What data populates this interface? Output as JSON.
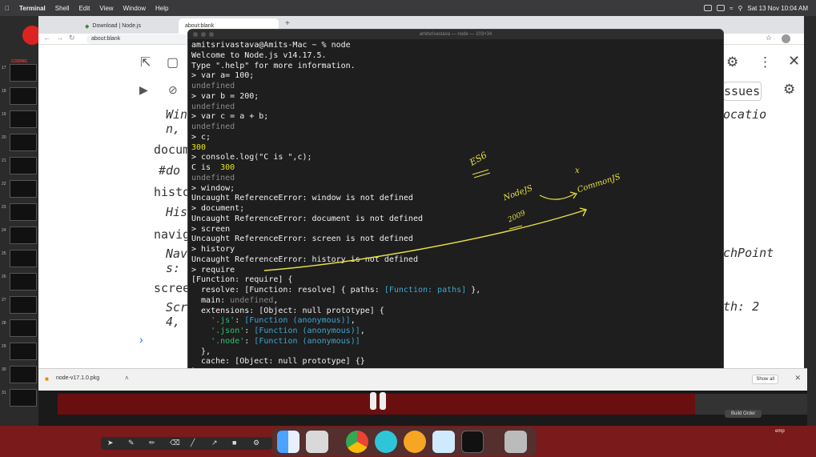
{
  "menubar": {
    "app": "Terminal",
    "items": [
      "Shell",
      "Edit",
      "View",
      "Window",
      "Help"
    ],
    "datetime": "Sat 13 Nov  10:04 AM"
  },
  "slides": {
    "brand": "CODING MENTORS",
    "numbers": [
      "17",
      "18",
      "19",
      "20",
      "21",
      "22",
      "23",
      "24",
      "25",
      "26",
      "27",
      "28",
      "29",
      "30",
      "31"
    ]
  },
  "browser": {
    "tabs": [
      {
        "label": "Download | Node.js"
      },
      {
        "label": "about:blank"
      }
    ],
    "url": "about:blank"
  },
  "devtools": {
    "left_rows": [
      "Win",
      "n,",
      "docum",
      "#do",
      "histo",
      "His",
      "navig",
      "Nav",
      "s:",
      "scree",
      "Scr",
      "4,"
    ],
    "right_rows": [
      "ssues",
      "ocatio",
      "chPoint",
      "th: 2"
    ]
  },
  "terminal": {
    "title": "amitsrivastava — node — 103×34",
    "lines": [
      [
        {
          "t": "amitsrivastava@Amits-Mac ~ % node",
          "c": ""
        }
      ],
      [
        {
          "t": "Welcome to Node.js v14.17.5.",
          "c": ""
        }
      ],
      [
        {
          "t": "Type \".help\" for more information.",
          "c": ""
        }
      ],
      [
        {
          "t": "> var a= 100;",
          "c": ""
        }
      ],
      [
        {
          "t": "undefined",
          "c": "undef"
        }
      ],
      [
        {
          "t": "> var b = 200;",
          "c": ""
        }
      ],
      [
        {
          "t": "undefined",
          "c": "undef"
        }
      ],
      [
        {
          "t": "> var c = a + b;",
          "c": ""
        }
      ],
      [
        {
          "t": "undefined",
          "c": "undef"
        }
      ],
      [
        {
          "t": "> c;",
          "c": ""
        }
      ],
      [
        {
          "t": "300",
          "c": "num"
        }
      ],
      [
        {
          "t": "> console.log(\"C is \",c);",
          "c": ""
        }
      ],
      [
        {
          "t": "C is  ",
          "c": ""
        },
        {
          "t": "300",
          "c": "num"
        }
      ],
      [
        {
          "t": "undefined",
          "c": "undef"
        }
      ],
      [
        {
          "t": "> window;",
          "c": ""
        }
      ],
      [
        {
          "t": "Uncaught ReferenceError: window is not defined",
          "c": ""
        }
      ],
      [
        {
          "t": "> document;",
          "c": ""
        }
      ],
      [
        {
          "t": "Uncaught ReferenceError: document is not defined",
          "c": ""
        }
      ],
      [
        {
          "t": "> screen",
          "c": ""
        }
      ],
      [
        {
          "t": "Uncaught ReferenceError: screen is not defined",
          "c": ""
        }
      ],
      [
        {
          "t": "> history",
          "c": ""
        }
      ],
      [
        {
          "t": "Uncaught ReferenceError: history is not defined",
          "c": ""
        }
      ],
      [
        {
          "t": "> require",
          "c": ""
        }
      ],
      [
        {
          "t": "[Function: require] {",
          "c": ""
        }
      ],
      [
        {
          "t": "  resolve: [Function: resolve] { paths: ",
          "c": ""
        },
        {
          "t": "[Function: paths]",
          "c": "fn"
        },
        {
          "t": " },",
          "c": ""
        }
      ],
      [
        {
          "t": "  main: ",
          "c": ""
        },
        {
          "t": "undefined",
          "c": "undef"
        },
        {
          "t": ",",
          "c": ""
        }
      ],
      [
        {
          "t": "  extensions: [Object: null prototype] {",
          "c": ""
        }
      ],
      [
        {
          "t": "    ",
          "c": ""
        },
        {
          "t": "'.js'",
          "c": "str"
        },
        {
          "t": ": ",
          "c": ""
        },
        {
          "t": "[Function (anonymous)]",
          "c": "fn"
        },
        {
          "t": ",",
          "c": ""
        }
      ],
      [
        {
          "t": "    ",
          "c": ""
        },
        {
          "t": "'.json'",
          "c": "str"
        },
        {
          "t": ": ",
          "c": ""
        },
        {
          "t": "[Function (anonymous)]",
          "c": "fn"
        },
        {
          "t": ",",
          "c": ""
        }
      ],
      [
        {
          "t": "    ",
          "c": ""
        },
        {
          "t": "'.node'",
          "c": "str"
        },
        {
          "t": ": ",
          "c": ""
        },
        {
          "t": "[Function (anonymous)]",
          "c": "fn"
        }
      ],
      [
        {
          "t": "  },",
          "c": ""
        }
      ],
      [
        {
          "t": "  cache: [Object: null prototype] {}",
          "c": ""
        }
      ],
      [
        {
          "t": "}",
          "c": ""
        }
      ],
      [
        {
          "t": "> ",
          "c": ""
        }
      ]
    ]
  },
  "annotations": {
    "es6": "ES6",
    "nodejs": "NodeJS",
    "year": "2009",
    "commonjs": "CommonJS",
    "x_mark": "x"
  },
  "download_bar": {
    "file": "node-v17.1.0.pkg",
    "show_all": "Show all"
  },
  "lower": {
    "build_order": "Build Order",
    "emp": "emp"
  },
  "colors": {
    "terminal_bg": "#1e1e1e",
    "undefined": "#8a8a8a",
    "number": "#e5e510",
    "function": "#3ea6d1",
    "string": "#2bc275",
    "ink": "#e8e040"
  },
  "dock_icons": [
    "finder-icon",
    "launchpad-icon",
    "chrome-icon",
    "webstorm-icon",
    "slack-icon",
    "preview-icon",
    "terminal-icon",
    "trash-icon"
  ]
}
